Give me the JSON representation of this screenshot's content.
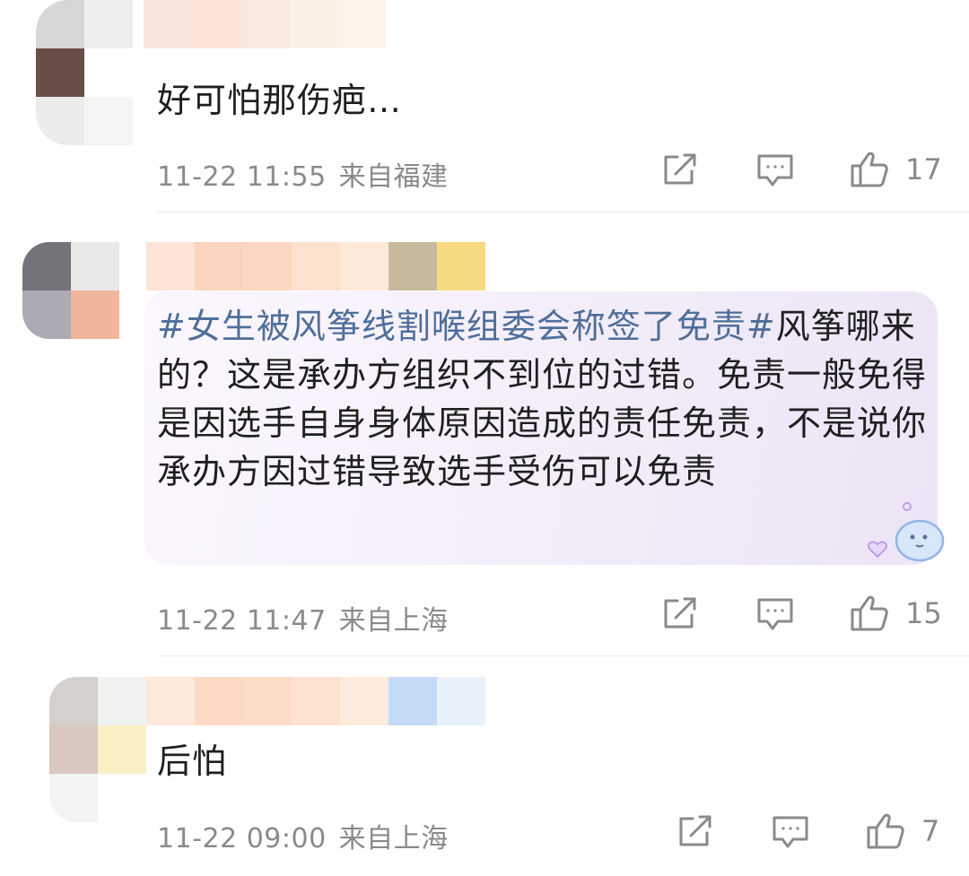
{
  "comments": [
    {
      "text": "好可怕那伤疤…",
      "time": "11-22 11:55",
      "location": "来自福建",
      "likes": "17",
      "icons": [
        "share-icon",
        "comment-icon",
        "thumbs-up-icon"
      ]
    },
    {
      "hashtag": "#女生被风筝线割喉组委会称签了免责#",
      "text": "风筝哪来的？这是承办方组织不到位的过错。免责一般免得是因选手自身身体原因造成的责任免责，不是说你承办方因过错导致选手受伤可以免责",
      "time": "11-22 11:47",
      "location": "来自上海",
      "likes": "15",
      "icons": [
        "share-icon",
        "comment-icon",
        "thumbs-up-icon"
      ]
    },
    {
      "text": "后怕",
      "time": "11-22 09:00",
      "location": "来自上海",
      "likes": "7",
      "icons": [
        "share-icon",
        "comment-icon",
        "thumbs-up-icon"
      ]
    }
  ]
}
